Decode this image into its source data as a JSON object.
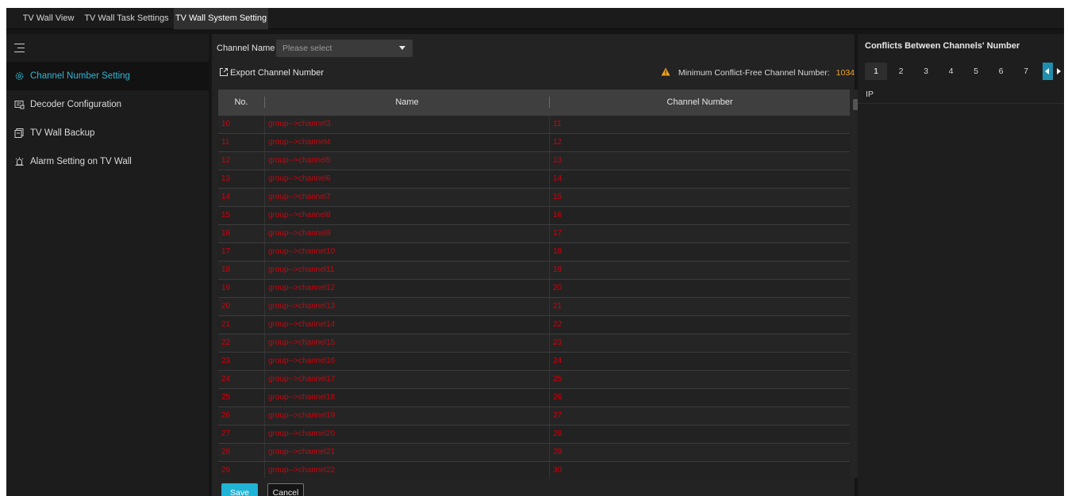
{
  "tabs": [
    {
      "label": "TV Wall View",
      "active": false
    },
    {
      "label": "TV Wall Task Settings",
      "active": false
    },
    {
      "label": "TV Wall System Setting",
      "active": true
    }
  ],
  "sidebar": {
    "items": [
      {
        "label": "Channel Number Setting",
        "icon": "gear-icon",
        "active": true
      },
      {
        "label": "Decoder Configuration",
        "icon": "decoder-icon",
        "active": false
      },
      {
        "label": "TV Wall Backup",
        "icon": "backup-icon",
        "active": false
      },
      {
        "label": "Alarm Setting on TV Wall",
        "icon": "alarm-icon",
        "active": false
      }
    ]
  },
  "filter": {
    "label": "Channel Name",
    "placeholder": "Please select"
  },
  "toolbar": {
    "export_label": "Export Channel Number",
    "warning_label": "Minimum Conflict-Free Channel Number:",
    "warning_value": "1034"
  },
  "table": {
    "columns": [
      "No.",
      "Name",
      "Channel Number"
    ],
    "rows": [
      [
        "10",
        "group-->channel3",
        "11"
      ],
      [
        "11",
        "group-->channel4",
        "12"
      ],
      [
        "12",
        "group-->channel5",
        "13"
      ],
      [
        "13",
        "group-->channel6",
        "14"
      ],
      [
        "14",
        "group-->channel7",
        "15"
      ],
      [
        "15",
        "group-->channel8",
        "16"
      ],
      [
        "16",
        "group-->channel9",
        "17"
      ],
      [
        "17",
        "group-->channel10",
        "18"
      ],
      [
        "18",
        "group-->channel11",
        "19"
      ],
      [
        "19",
        "group-->channel12",
        "20"
      ],
      [
        "20",
        "group-->channel13",
        "21"
      ],
      [
        "21",
        "group-->channel14",
        "22"
      ],
      [
        "22",
        "group-->channel15",
        "23"
      ],
      [
        "23",
        "group-->channel16",
        "24"
      ],
      [
        "24",
        "group-->channel17",
        "25"
      ],
      [
        "25",
        "group-->channel18",
        "26"
      ],
      [
        "26",
        "group-->channel19",
        "27"
      ],
      [
        "27",
        "group-->channel20",
        "28"
      ],
      [
        "28",
        "group-->channel21",
        "29"
      ],
      [
        "29",
        "group-->channel22",
        "30"
      ]
    ]
  },
  "footer": {
    "save_label": "Save",
    "cancel_label": "Cancel"
  },
  "conflicts": {
    "title": "Conflicts Between Channels' Number",
    "pages": [
      "1",
      "2",
      "3",
      "4",
      "5",
      "6",
      "7"
    ],
    "active_page": "1",
    "column_header": "IP"
  },
  "colors": {
    "accent": "#1fb3d5",
    "active_nav_text": "#2fb5d6",
    "conflict_text": "#d3000a",
    "warning_value": "#f0a42a"
  }
}
